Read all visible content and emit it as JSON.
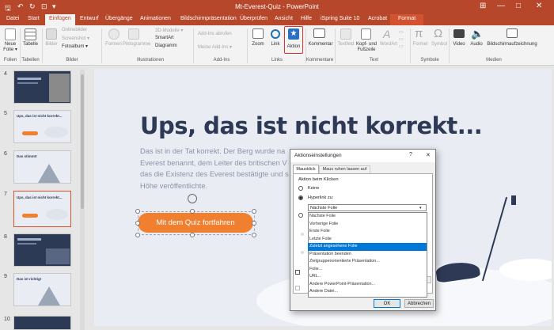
{
  "window": {
    "title": "Mt-Everest-Quiz - PowerPoint",
    "controls": [
      "—",
      "□",
      "✕"
    ]
  },
  "tabs": [
    {
      "label": "Datei"
    },
    {
      "label": "Start"
    },
    {
      "label": "Einfügen"
    },
    {
      "label": "Entwurf"
    },
    {
      "label": "Übergänge"
    },
    {
      "label": "Animationen"
    },
    {
      "label": "Bildschirmpräsentation"
    },
    {
      "label": "Überprüfen"
    },
    {
      "label": "Ansicht"
    },
    {
      "label": "Hilfe"
    },
    {
      "label": "iSpring Suite 10"
    },
    {
      "label": "Acrobat"
    },
    {
      "label": "Format"
    }
  ],
  "ribbon": {
    "new_slide": "Neue\nFolie ▾",
    "table": "Tabelle",
    "images": "Bilder",
    "online_images": "Onlinebilder",
    "screenshot": "Screenshot ▾",
    "photo_album": "Fotoalbum ▾",
    "shapes": "Formen",
    "pictograms": "Piktogramme",
    "models_3d": "3D-Modelle ▾",
    "smartart": "SmartArt",
    "diagram": "Diagramm",
    "get_addins": "Add-Ins abrufen",
    "my_addins": "Meine Add-Ins ▾",
    "zoom": "Zoom",
    "link": "Link",
    "action": "Aktion",
    "comment": "Kommentar",
    "textfield": "Textfeld",
    "header_footer": "Kopf- und\nFußzeile",
    "wordart": "WordArt",
    "formula": "Formel",
    "symbol": "Symbol",
    "video": "Video",
    "audio": "Audio",
    "screen_recording": "Bildschirmaufzeichnung",
    "groups": {
      "slides": "Folien",
      "tables": "Tabellen",
      "images": "Bilder",
      "illustrations": "Illustrationen",
      "addins": "Add-Ins",
      "links": "Links",
      "comments": "Kommentare",
      "text": "Text",
      "symbols": "Symbole",
      "media": "Medien"
    }
  },
  "thumbnails": [
    {
      "num": "4",
      "title": ""
    },
    {
      "num": "5",
      "title": "Ups, das ist nicht korrekt..."
    },
    {
      "num": "6",
      "title": "Das stimmt!"
    },
    {
      "num": "7",
      "title": "Ups, das ist nicht korrekt..."
    },
    {
      "num": "8",
      "title": ""
    },
    {
      "num": "9",
      "title": "Das ist richtig!"
    },
    {
      "num": "10",
      "title": ""
    }
  ],
  "slide": {
    "title": "Ups, das ist nicht korrekt...",
    "body_lines": [
      "Das ist in der Tat korrekt. Der Berg wurde na",
      "Everest benannt, dem Leiter des britischen V",
      "das die Existenz des Everest bestätigte und s",
      "Höhe veröffentlichte."
    ],
    "button_label": "Mit dem Quiz fortfahren"
  },
  "dialog": {
    "title": "Aktionseinstellungen",
    "help": "?",
    "close": "✕",
    "tabs": [
      "Mausklick",
      "Maus ruhen lassen auf"
    ],
    "section": "Aktion beim Klicken",
    "radio_none": "Keine",
    "radio_hyperlink": "Hyperlink zu:",
    "combo_value": "Nächste Folie",
    "options": [
      "Nächste Folie",
      "Vorherige Folie",
      "Erste Folie",
      "Letzte Folie",
      "Zuletzt angesehene Folie",
      "Präsentation beenden",
      "Zielgruppenorientierte Präsentation...",
      "Folie...",
      "URL...",
      "Andere PowerPoint-Präsentation...",
      "Andere Datei..."
    ],
    "selected_index": 4,
    "ok": "OK",
    "cancel": "Abbrechen"
  },
  "colors": {
    "accent": "#b7472a",
    "slide_title": "#2e3a55",
    "button_orange": "#f08030",
    "selection_blue": "#0078d7",
    "highlight_red": "#e03030"
  }
}
